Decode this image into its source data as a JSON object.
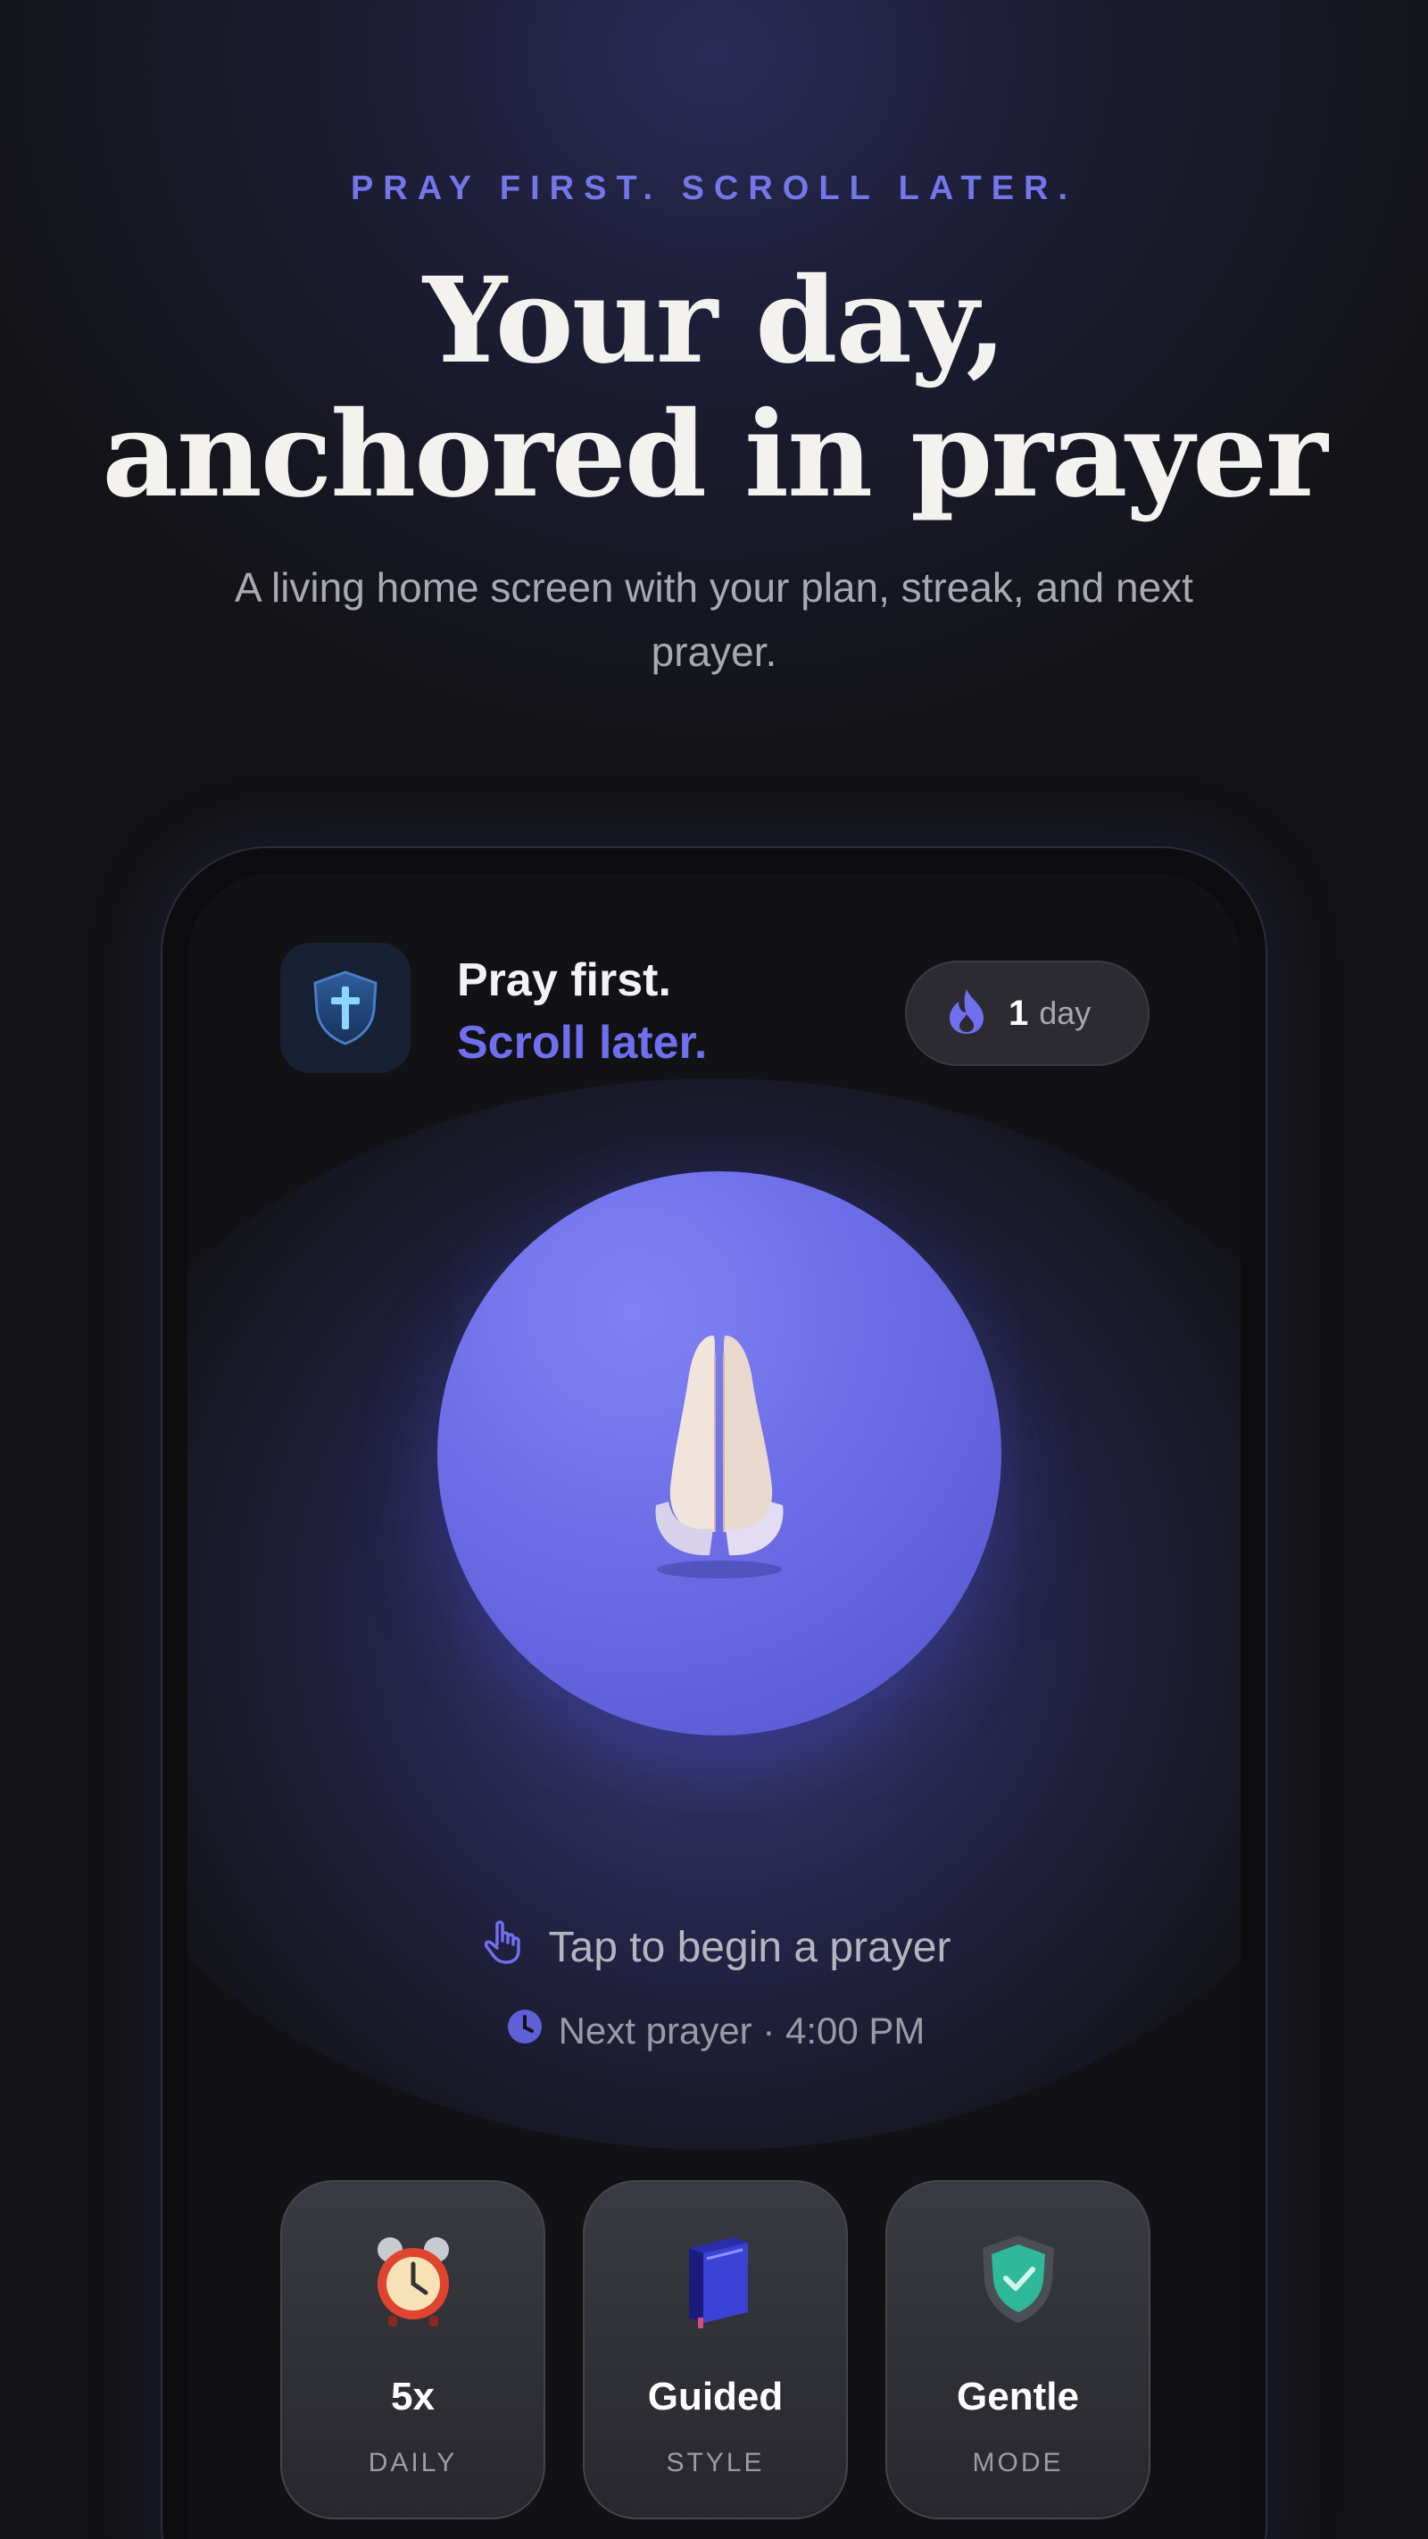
{
  "hero": {
    "eyebrow": "PRAY FIRST. SCROLL LATER.",
    "title_line1": "Your day,",
    "title_line2": "anchored in prayer",
    "subtitle": "A living home screen with your plan, streak, and next prayer."
  },
  "app": {
    "icon": "shield-cross-icon",
    "brand_line1": "Pray first.",
    "brand_line2": "Scroll later.",
    "streak": {
      "icon": "flame-icon",
      "count": "1",
      "unit": "day"
    },
    "main_button_icon": "praying-hands-icon",
    "tap_prompt": {
      "icon": "tap-hand-icon",
      "text": "Tap to begin a prayer"
    },
    "next_prayer": {
      "icon": "clock-icon",
      "text": "Next prayer · 4:00 PM"
    },
    "cards": [
      {
        "icon": "alarm-clock-icon",
        "value": "5x",
        "label": "DAILY"
      },
      {
        "icon": "book-icon",
        "value": "Guided",
        "label": "STYLE"
      },
      {
        "icon": "shield-check-icon",
        "value": "Gentle",
        "label": "MODE"
      }
    ]
  },
  "colors": {
    "accent": "#6f6ff0",
    "eyebrow": "#7377ea",
    "background": "#131316",
    "circle": "#6b6ce6"
  }
}
